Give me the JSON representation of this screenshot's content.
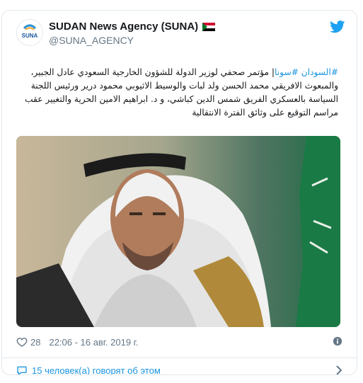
{
  "tweet": {
    "display_name": "SUDAN News Agency (SUNA)",
    "handle": "@SUNA_AGENCY",
    "avatar_label": "SUNA",
    "flag_icon": "sudan-flag-icon",
    "text_parts": [
      {
        "type": "hashtag",
        "text": "#السودان"
      },
      {
        "type": "hashtag",
        "text": "#سونا"
      },
      {
        "type": "text",
        "text": "| مؤتمر صحفي لوزير الدولة للشؤون الخارجية السعودي عادل الجبير، والمبعوث الافريقي محمد الحسن ولد لبات والوسيط الاثيوبي محمود درير ورئيس اللجنة السياسة بالعسكري الفريق شمس الدين كباشي، و د. ابراهيم الامين الحرية والتغيير عقب مراسم التوقيع على وثائق الفترة الانتقالية"
      }
    ],
    "likes": "28",
    "timestamp": "22:06 - 16 авг. 2019 г.",
    "conversation_link": "15 человек(а) говорят об этом"
  },
  "colors": {
    "link": "#1b95e0",
    "muted": "#657786",
    "border": "#e1e8ed"
  }
}
